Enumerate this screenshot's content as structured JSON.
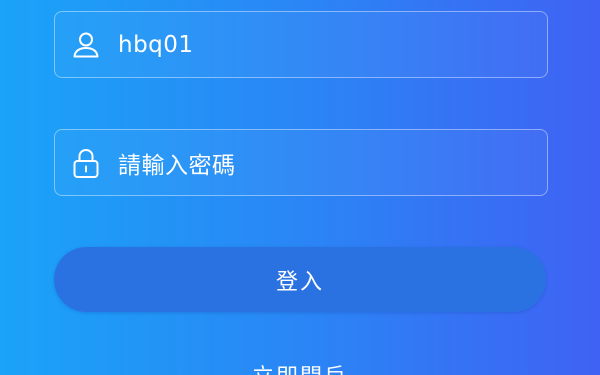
{
  "login_form": {
    "username": {
      "icon": "user-icon",
      "value": "hbq01"
    },
    "password": {
      "icon": "lock-icon",
      "placeholder": "請輸入密碼"
    },
    "login_button_label": "登入",
    "bottom_link_label": "立即開戶"
  },
  "colors": {
    "background_left": "#1aa3f8",
    "background_right": "#3f62f4",
    "button": "#2a72e2",
    "text": "#ffffff"
  }
}
